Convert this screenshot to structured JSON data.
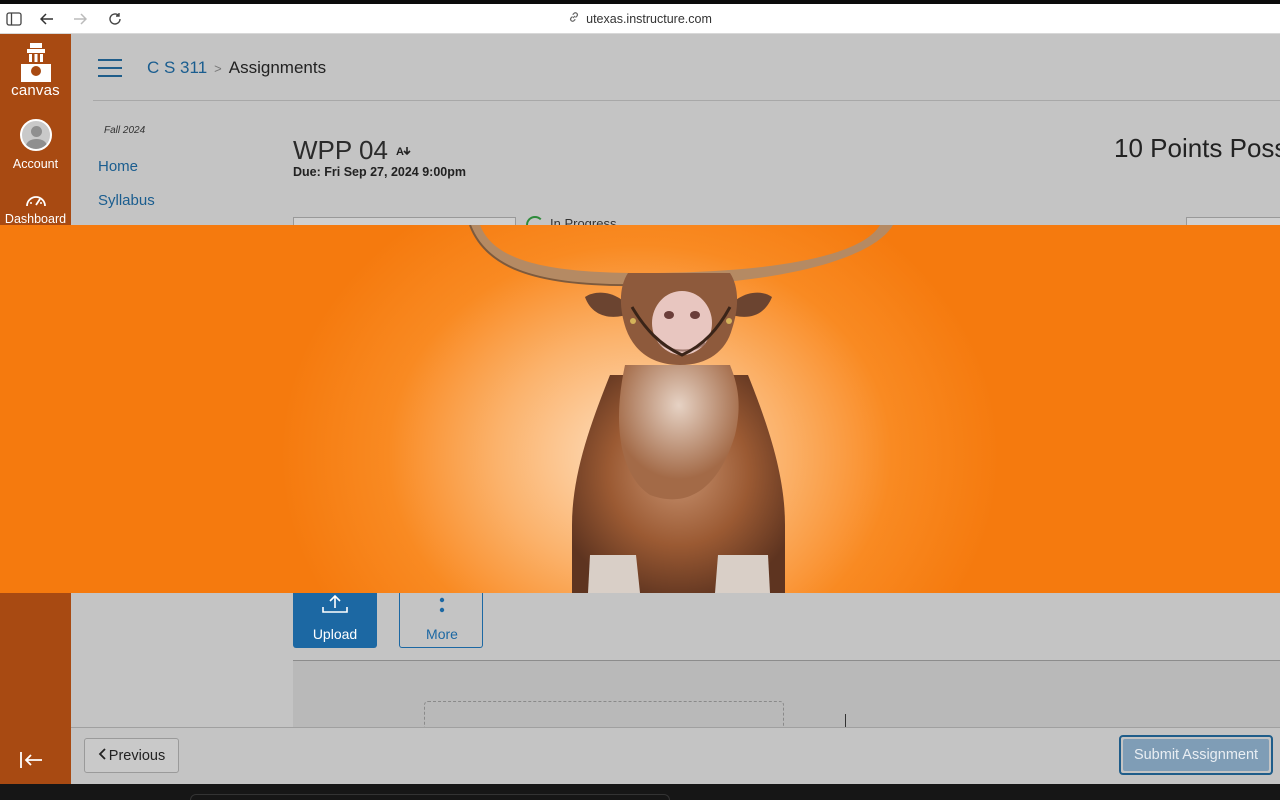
{
  "browser": {
    "url": "utexas.instructure.com",
    "icons": [
      "sidebar-toggle-icon",
      "back-icon",
      "forward-icon",
      "reload-icon",
      "link-icon"
    ]
  },
  "global_nav": {
    "logo_label": "canvas",
    "account_label": "Account",
    "dashboard_label": "Dashboard",
    "color": "#a84a12"
  },
  "breadcrumb": {
    "course": "C S 311",
    "page": "Assignments"
  },
  "course_nav": {
    "term": "Fall 2024",
    "items": [
      {
        "label": "Home"
      },
      {
        "label": "Syllabus"
      }
    ]
  },
  "assignment": {
    "title": "WPP 04",
    "due": "Due: Fri Sep 27, 2024 9:00pm",
    "points": "10 Points Poss",
    "status_partial": "In Progress"
  },
  "submission": {
    "upload_label": "Upload",
    "more_label": "More"
  },
  "footer": {
    "previous_label": "Previous",
    "submit_label": "Submit Assignment"
  },
  "overlay": {
    "subject": "longhorn-steer-image",
    "bg_color": "#f57a0e"
  }
}
